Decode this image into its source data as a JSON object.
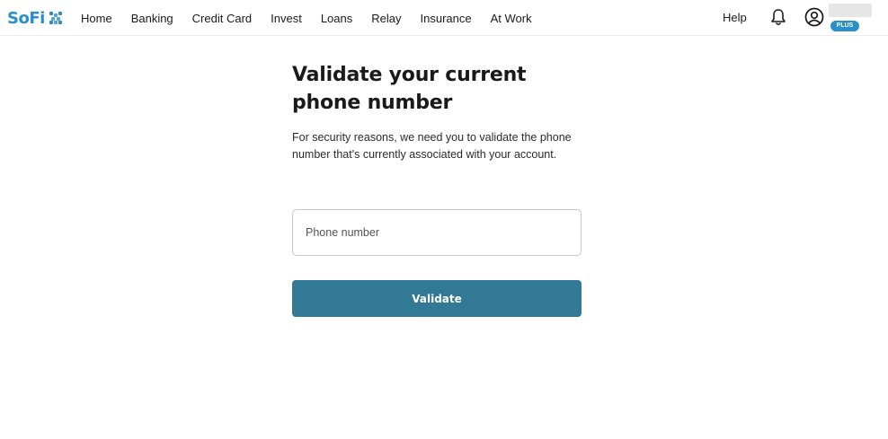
{
  "brand": {
    "name": "SoFi",
    "color": "#2a8fc9"
  },
  "nav": {
    "items": [
      "Home",
      "Banking",
      "Credit Card",
      "Invest",
      "Loans",
      "Relay",
      "Insurance",
      "At Work"
    ]
  },
  "header": {
    "help_label": "Help",
    "bell_icon": "bell-icon",
    "user_icon": "user-circle-icon",
    "membership_badge": "PLUS"
  },
  "main": {
    "title": "Validate your current phone number",
    "description": "For security reasons, we need you to validate the phone number that's currently associated with your account.",
    "phone_field": {
      "placeholder": "Phone number",
      "value": ""
    },
    "validate_label": "Validate",
    "button_color": "#317994"
  }
}
